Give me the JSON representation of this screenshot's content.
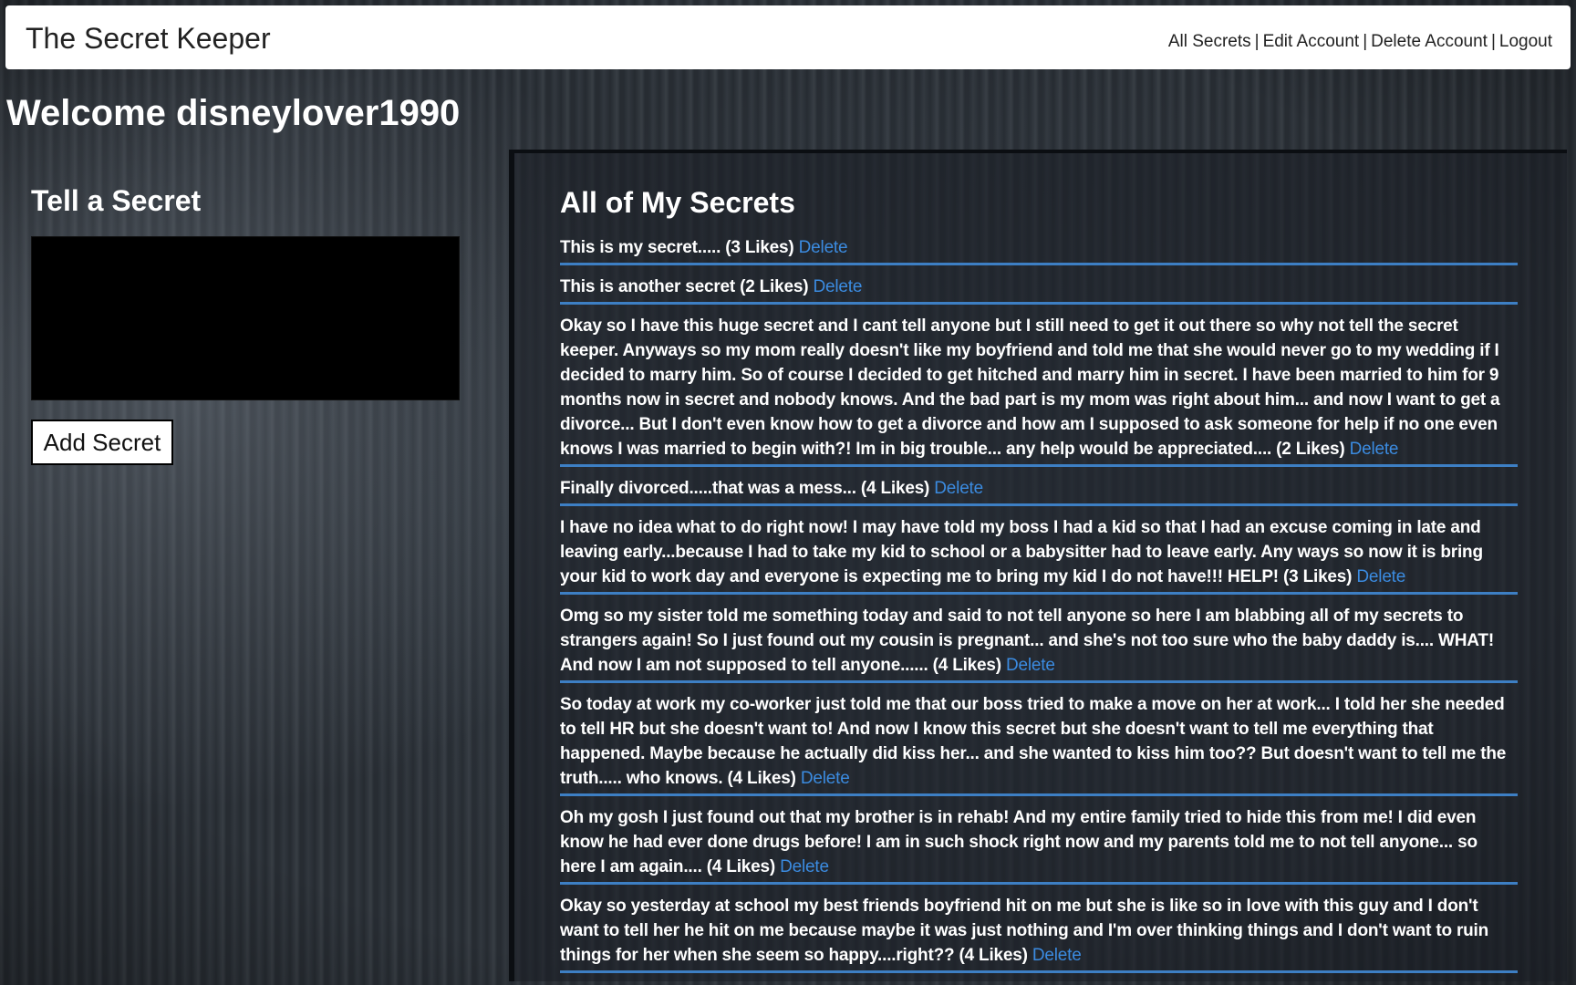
{
  "navbar": {
    "brand": "The Secret Keeper",
    "links": {
      "all_secrets": "All Secrets",
      "edit_account": "Edit Account",
      "delete_account": "Delete Account",
      "logout": "Logout"
    },
    "separator": "|"
  },
  "welcome": "Welcome disneylover1990",
  "tell_secret": {
    "heading": "Tell a Secret",
    "textarea_value": "",
    "button_label": "Add Secret"
  },
  "my_secrets": {
    "heading": "All of My Secrets",
    "delete_label": "Delete",
    "items": [
      {
        "text": "This is my secret..... (3 Likes)"
      },
      {
        "text": "This is another secret (2 Likes)"
      },
      {
        "text": "Okay so I have this huge secret and I cant tell anyone but I still need to get it out there so why not tell the secret keeper. Anyways so my mom really doesn't like my boyfriend and told me that she would never go to my wedding if I decided to marry him. So of course I decided to get hitched and marry him in secret. I have been married to him for 9 months now in secret and nobody knows. And the bad part is my mom was right about him... and now I want to get a divorce... But I don't even know how to get a divorce and how am I supposed to ask someone for help if no one even knows I was married to begin with?! Im in big trouble... any help would be appreciated.... (2 Likes)"
      },
      {
        "text": "Finally divorced.....that was a mess... (4 Likes)"
      },
      {
        "text": "I have no idea what to do right now! I may have told my boss I had a kid so that I had an excuse coming in late and leaving early...because I had to take my kid to school or a babysitter had to leave early. Any ways so now it is bring your kid to work day and everyone is expecting me to bring my kid I do not have!!! HELP! (3 Likes)"
      },
      {
        "text": "Omg so my sister told me something today and said to not tell anyone so here I am blabbing all of my secrets to strangers again! So I just found out my cousin is pregnant... and she's not too sure who the baby daddy is.... WHAT! And now I am not supposed to tell anyone...... (4 Likes)"
      },
      {
        "text": "So today at work my co-worker just told me that our boss tried to make a move on her at work... I told her she needed to tell HR but she doesn't want to! And now I know this secret but she doesn't want to tell me everything that happened. Maybe because he actually did kiss her... and she wanted to kiss him too?? But doesn't want to tell me the truth..... who knows. (4 Likes)"
      },
      {
        "text": "Oh my gosh I just found out that my brother is in rehab! And my entire family tried to hide this from me! I did even know he had ever done drugs before! I am in such shock right now and my parents told me to not tell anyone... so here I am again.... (4 Likes)"
      },
      {
        "text": "Okay so yesterday at school my best friends boyfriend hit on me but she is like so in love with this guy and I don't want to tell her he hit on me because maybe it was just nothing and I'm over thinking things and I don't want to ruin things for her when she seem so happy....right?? (4 Likes)"
      }
    ]
  },
  "colors": {
    "navbar_bg": "#ffffff",
    "link_blue": "#3b8be0",
    "divider_blue": "#3d7fc4",
    "input_bg": "#000000"
  }
}
